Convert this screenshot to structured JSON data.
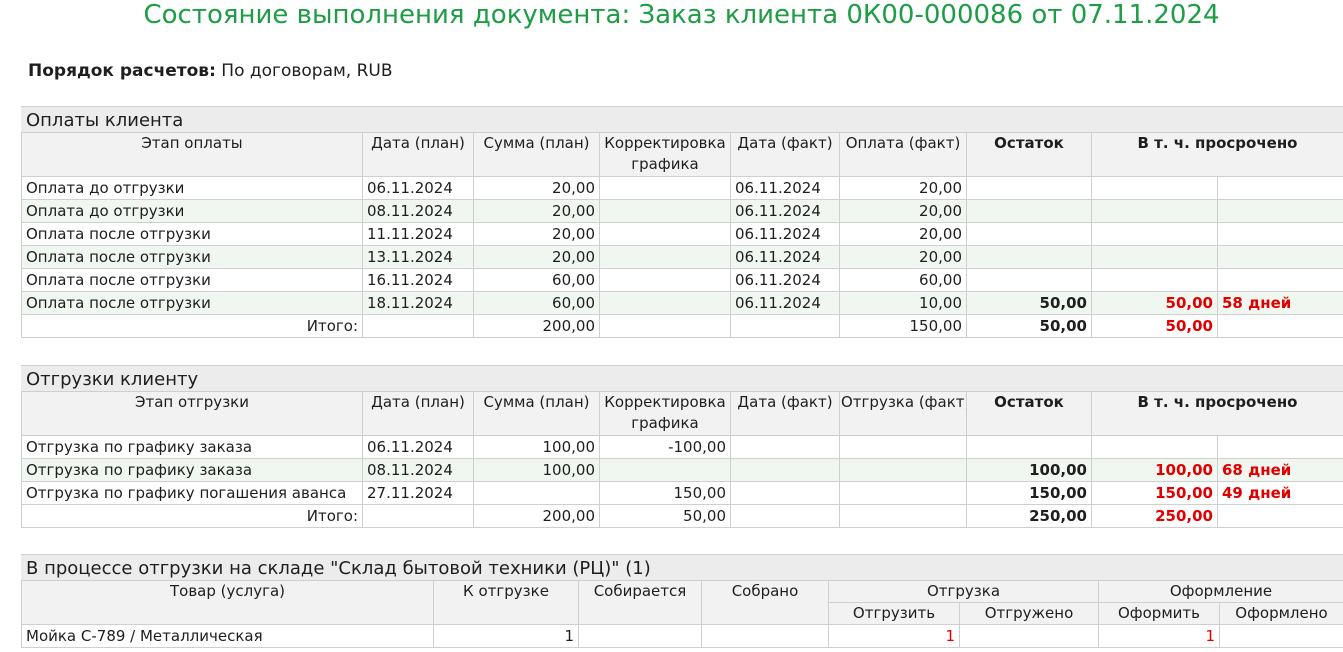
{
  "title": "Состояние выполнения документа: Заказ клиента 0К00-000086 от 07.11.2024",
  "settlement": {
    "label": "Порядок расчетов:",
    "value": "По договорам, RUB"
  },
  "payments": {
    "title": "Оплаты клиента",
    "headers": {
      "stage": "Этап оплаты",
      "date_plan": "Дата (план)",
      "sum_plan": "Сумма (план)",
      "correction_1": "Корректировка",
      "correction_2": "графика",
      "date_fact": "Дата (факт)",
      "amount_fact": "Оплата (факт)",
      "remainder": "Остаток",
      "overdue": "В т. ч. просрочено"
    },
    "rows": [
      {
        "stage": "Оплата до отгрузки",
        "date_plan": "06.11.2024",
        "sum_plan": "20,00",
        "correction": "",
        "date_fact": "06.11.2024",
        "amount_fact": "20,00",
        "remainder": "",
        "overdue": "",
        "days": ""
      },
      {
        "stage": "Оплата до отгрузки",
        "date_plan": "08.11.2024",
        "sum_plan": "20,00",
        "correction": "",
        "date_fact": "06.11.2024",
        "amount_fact": "20,00",
        "remainder": "",
        "overdue": "",
        "days": ""
      },
      {
        "stage": "Оплата после отгрузки",
        "date_plan": "11.11.2024",
        "sum_plan": "20,00",
        "correction": "",
        "date_fact": "06.11.2024",
        "amount_fact": "20,00",
        "remainder": "",
        "overdue": "",
        "days": ""
      },
      {
        "stage": "Оплата после отгрузки",
        "date_plan": "13.11.2024",
        "sum_plan": "20,00",
        "correction": "",
        "date_fact": "06.11.2024",
        "amount_fact": "20,00",
        "remainder": "",
        "overdue": "",
        "days": ""
      },
      {
        "stage": "Оплата после отгрузки",
        "date_plan": "16.11.2024",
        "sum_plan": "60,00",
        "correction": "",
        "date_fact": "06.11.2024",
        "amount_fact": "60,00",
        "remainder": "",
        "overdue": "",
        "days": ""
      },
      {
        "stage": "Оплата после отгрузки",
        "date_plan": "18.11.2024",
        "sum_plan": "60,00",
        "correction": "",
        "date_fact": "06.11.2024",
        "amount_fact": "10,00",
        "remainder": "50,00",
        "overdue": "50,00",
        "days": "58 дней"
      }
    ],
    "total": {
      "label": "Итого:",
      "sum_plan": "200,00",
      "correction": "",
      "amount_fact": "150,00",
      "remainder": "50,00",
      "overdue": "50,00"
    }
  },
  "shipments": {
    "title": "Отгрузки клиенту",
    "headers": {
      "stage": "Этап отгрузки",
      "date_plan": "Дата (план)",
      "sum_plan": "Сумма (план)",
      "correction_1": "Корректировка",
      "correction_2": "графика",
      "date_fact": "Дата (факт)",
      "amount_fact": "Отгрузка (факт)",
      "remainder": "Остаток",
      "overdue": "В т. ч. просрочено"
    },
    "rows": [
      {
        "stage": "Отгрузка по графику заказа",
        "date_plan": "06.11.2024",
        "sum_plan": "100,00",
        "correction": "-100,00",
        "date_fact": "",
        "amount_fact": "",
        "remainder": "",
        "overdue": "",
        "days": ""
      },
      {
        "stage": "Отгрузка по графику заказа",
        "date_plan": "08.11.2024",
        "sum_plan": "100,00",
        "correction": "",
        "date_fact": "",
        "amount_fact": "",
        "remainder": "100,00",
        "overdue": "100,00",
        "days": "68 дней"
      },
      {
        "stage": "Отгрузка по графику погашения аванса",
        "date_plan": "27.11.2024",
        "sum_plan": "",
        "correction": "150,00",
        "date_fact": "",
        "amount_fact": "",
        "remainder": "150,00",
        "overdue": "150,00",
        "days": "49 дней"
      }
    ],
    "total": {
      "label": "Итого:",
      "sum_plan": "200,00",
      "correction": "50,00",
      "amount_fact": "",
      "remainder": "250,00",
      "overdue": "250,00"
    }
  },
  "warehouse": {
    "title": "В процессе отгрузки на складе \"Склад бытовой техники (РЦ)\" (1)",
    "headers": {
      "item": "Товар (услуга)",
      "to_ship": "К отгрузке",
      "collecting": "Собирается",
      "collected": "Собрано",
      "shipment": "Отгрузка",
      "ship": "Отгрузить",
      "shipped": "Отгружено",
      "registration": "Оформление",
      "register": "Оформить",
      "registered": "Оформлено"
    },
    "rows": [
      {
        "item": "Мойка С-789 / Металлическая",
        "to_ship": "1",
        "collecting": "",
        "collected": "",
        "ship": "1",
        "shipped": "",
        "register": "1",
        "registered": ""
      }
    ]
  },
  "colors": {
    "title": "#1e9c46",
    "overdue": "#e00000",
    "alt_row": "#f0f7f1",
    "header_bg": "#f2f2f2"
  }
}
